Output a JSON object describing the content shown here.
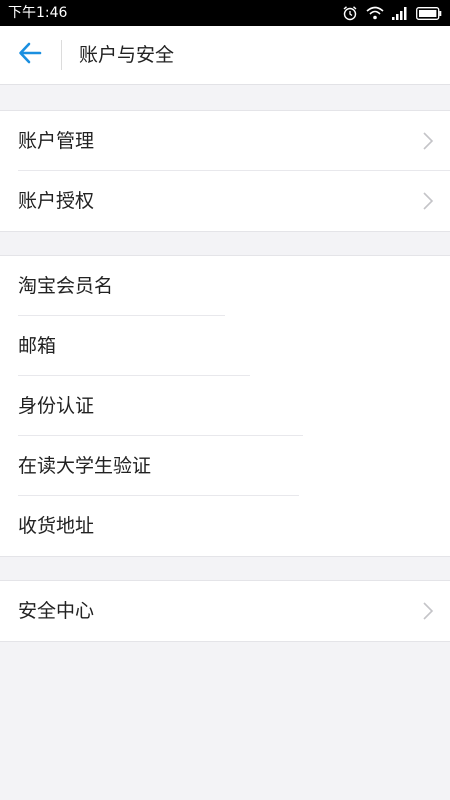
{
  "status_bar": {
    "time": "下午1:46",
    "icons": [
      "alarm-icon",
      "wifi-icon",
      "signal-icon",
      "battery-icon"
    ]
  },
  "nav": {
    "title": "账户与安全",
    "back_icon": "arrow-left-icon",
    "accent_color": "#1a8fe0"
  },
  "groups": [
    {
      "items": [
        {
          "label": "账户管理",
          "chevron": true
        },
        {
          "label": "账户授权",
          "chevron": true
        }
      ]
    },
    {
      "items": [
        {
          "label": "淘宝会员名",
          "chevron": false
        },
        {
          "label": "邮箱",
          "chevron": false
        },
        {
          "label": "身份认证",
          "chevron": false
        },
        {
          "label": "在读大学生验证",
          "chevron": false
        },
        {
          "label": "收货地址",
          "chevron": false
        }
      ]
    },
    {
      "items": [
        {
          "label": "安全中心",
          "chevron": true
        }
      ]
    }
  ]
}
